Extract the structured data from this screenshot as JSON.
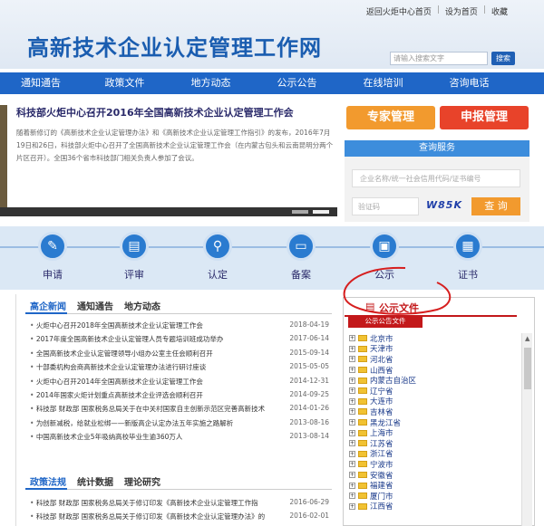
{
  "top_links": [
    "返回火炬中心首页",
    "设为首页",
    "收藏"
  ],
  "site_title": "高新技术企业认定管理工作网",
  "search": {
    "placeholder": "请输入搜索文字",
    "button": "搜索"
  },
  "nav": [
    "通知通告",
    "政策文件",
    "地方动态",
    "公示公告",
    "在线培训",
    "咨询电话"
  ],
  "banner": {
    "title": "科技部火炬中心召开2016年全国高新技术企业认定管理工作会",
    "text": "随着新修订的《高新技术企业认定管理办法》和《高新技术企业认定管理工作指引》的发布，2016年7月19日和26日，科技部火炬中心召开了全国高新技术企业认定管理工作会（在内蒙古包头和云南昆明分两个片区召开）。全国36个省市科技部门相关负责人参加了会议。"
  },
  "buttons": {
    "expert": "专家管理",
    "apply": "申报管理"
  },
  "query": {
    "title": "查询服务",
    "company_placeholder": "企业名称/统一社会信用代码/证书编号",
    "captcha_placeholder": "验证码",
    "captcha_value": "W85K",
    "button": "查 询"
  },
  "steps": [
    "申请",
    "评审",
    "认定",
    "备案",
    "公示",
    "证书"
  ],
  "news_tabs": [
    "高企新闻",
    "通知通告",
    "地方动态"
  ],
  "news": [
    {
      "title": "火炬中心召开2018年全国高新技术企业认定管理工作会",
      "date": "2018-04-19"
    },
    {
      "title": "2017年度全国高新技术企业认定管理人员专题培训班成功举办",
      "date": "2017-06-14"
    },
    {
      "title": "全国高新技术企业认定管理领导小组办公室主任会顺利召开",
      "date": "2015-09-14"
    },
    {
      "title": "十部委机构会商高新技术企业认定管理办法进行研讨座谈",
      "date": "2015-05-05"
    },
    {
      "title": "火炬中心召开2014年全国高新技术企业认定管理工作会",
      "date": "2014-12-31"
    },
    {
      "title": "2014年国家火炬计划重点高新技术企业评选会顺利召开",
      "date": "2014-09-25"
    },
    {
      "title": "科技部 财政部 国家税务总局关于在中关村国家自主创新示范区完善高新技术",
      "date": "2014-01-26"
    },
    {
      "title": "为创新减税，给就业松绑——新版高企认定办法五年实施之路解析",
      "date": "2013-08-16"
    },
    {
      "title": "中国高新技术企业5年吸纳高校毕业生逾360万人",
      "date": "2013-08-14"
    }
  ],
  "policy_tabs": [
    "政策法规",
    "统计数据",
    "理论研究"
  ],
  "policy": [
    {
      "title": "科技部 财政部 国家税务总局关于修订印发《高新技术企业认定管理工作指",
      "date": "2016-06-29"
    },
    {
      "title": "科技部 财政部 国家税务总局关于修订印发《高新技术企业认定管理办法》的",
      "date": "2016-02-01"
    }
  ],
  "public_panel": {
    "title": "公示文件",
    "sub": "公示公告文件",
    "regions": [
      "北京市",
      "天津市",
      "河北省",
      "山西省",
      "内蒙古自治区",
      "辽宁省",
      "大连市",
      "吉林省",
      "黑龙江省",
      "上海市",
      "江苏省",
      "浙江省",
      "宁波市",
      "安徽省",
      "福建省",
      "厦门市",
      "江西省"
    ]
  },
  "colors": {
    "nav_blue": "#1f66c7",
    "accent_orange": "#f29a2e",
    "accent_red": "#e8432a",
    "annotation_red": "#d61f1f"
  }
}
